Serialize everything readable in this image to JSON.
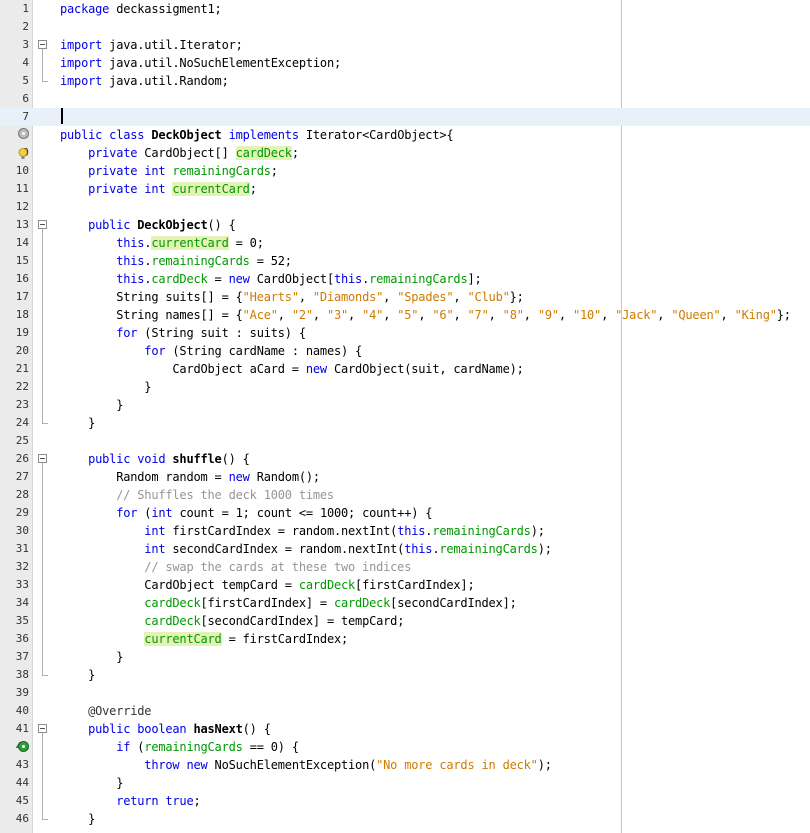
{
  "editor": {
    "lines": [
      {
        "n": "1",
        "parts": [
          {
            "t": "package",
            "c": "kw"
          },
          {
            "t": " deckassigment1;"
          }
        ]
      },
      {
        "n": "2",
        "parts": []
      },
      {
        "n": "3",
        "parts": [
          {
            "t": "import",
            "c": "kw"
          },
          {
            "t": " java.util.Iterator;"
          }
        ]
      },
      {
        "n": "4",
        "parts": [
          {
            "t": "import",
            "c": "kw"
          },
          {
            "t": " java.util.NoSuchElementException;"
          }
        ]
      },
      {
        "n": "5",
        "parts": [
          {
            "t": "import",
            "c": "kw"
          },
          {
            "t": " java.util.Random;"
          }
        ]
      },
      {
        "n": "6",
        "parts": []
      },
      {
        "n": "7",
        "parts": []
      },
      {
        "n": "8",
        "parts": [
          {
            "t": "public class ",
            "c": "kw"
          },
          {
            "t": "DeckObject",
            "c": "bold"
          },
          {
            "t": " implements",
            "c": "kw"
          },
          {
            "t": " Iterator<CardObject>{"
          }
        ]
      },
      {
        "n": "9",
        "parts": [
          {
            "t": "    private ",
            "c": "kw"
          },
          {
            "t": "CardObject[] "
          },
          {
            "t": "cardDeck",
            "c": "fld-hl"
          },
          {
            "t": ";"
          }
        ]
      },
      {
        "n": "10",
        "parts": [
          {
            "t": "    private int ",
            "c": "kw"
          },
          {
            "t": "remainingCards",
            "c": "fld"
          },
          {
            "t": ";"
          }
        ]
      },
      {
        "n": "11",
        "parts": [
          {
            "t": "    private int ",
            "c": "kw"
          },
          {
            "t": "currentCard",
            "c": "fld-hl"
          },
          {
            "t": ";"
          }
        ]
      },
      {
        "n": "12",
        "parts": []
      },
      {
        "n": "13",
        "parts": [
          {
            "t": "    public ",
            "c": "kw"
          },
          {
            "t": "DeckObject",
            "c": "bold"
          },
          {
            "t": "() {"
          }
        ]
      },
      {
        "n": "14",
        "parts": [
          {
            "t": "        this",
            "c": "kw"
          },
          {
            "t": "."
          },
          {
            "t": "currentCard",
            "c": "fld-hl"
          },
          {
            "t": " = 0;"
          }
        ]
      },
      {
        "n": "15",
        "parts": [
          {
            "t": "        this",
            "c": "kw"
          },
          {
            "t": "."
          },
          {
            "t": "remainingCards",
            "c": "fld"
          },
          {
            "t": " = 52;"
          }
        ]
      },
      {
        "n": "16",
        "parts": [
          {
            "t": "        this",
            "c": "kw"
          },
          {
            "t": "."
          },
          {
            "t": "cardDeck",
            "c": "fld"
          },
          {
            "t": " = "
          },
          {
            "t": "new",
            "c": "kw"
          },
          {
            "t": " CardObject["
          },
          {
            "t": "this",
            "c": "kw"
          },
          {
            "t": "."
          },
          {
            "t": "remainingCards",
            "c": "fld"
          },
          {
            "t": "];"
          }
        ]
      },
      {
        "n": "17",
        "parts": [
          {
            "t": "        String suits[] = {"
          },
          {
            "t": "\"Hearts\"",
            "c": "str"
          },
          {
            "t": ", "
          },
          {
            "t": "\"Diamonds\"",
            "c": "str"
          },
          {
            "t": ", "
          },
          {
            "t": "\"Spades\"",
            "c": "str"
          },
          {
            "t": ", "
          },
          {
            "t": "\"Club\"",
            "c": "str"
          },
          {
            "t": "};"
          }
        ]
      },
      {
        "n": "18",
        "parts": [
          {
            "t": "        String names[] = {"
          },
          {
            "t": "\"Ace\"",
            "c": "str"
          },
          {
            "t": ", "
          },
          {
            "t": "\"2\"",
            "c": "str"
          },
          {
            "t": ", "
          },
          {
            "t": "\"3\"",
            "c": "str"
          },
          {
            "t": ", "
          },
          {
            "t": "\"4\"",
            "c": "str"
          },
          {
            "t": ", "
          },
          {
            "t": "\"5\"",
            "c": "str"
          },
          {
            "t": ", "
          },
          {
            "t": "\"6\"",
            "c": "str"
          },
          {
            "t": ", "
          },
          {
            "t": "\"7\"",
            "c": "str"
          },
          {
            "t": ", "
          },
          {
            "t": "\"8\"",
            "c": "str"
          },
          {
            "t": ", "
          },
          {
            "t": "\"9\"",
            "c": "str"
          },
          {
            "t": ", "
          },
          {
            "t": "\"10\"",
            "c": "str"
          },
          {
            "t": ", "
          },
          {
            "t": "\"Jack\"",
            "c": "str"
          },
          {
            "t": ", "
          },
          {
            "t": "\"Queen\"",
            "c": "str"
          },
          {
            "t": ", "
          },
          {
            "t": "\"King\"",
            "c": "str"
          },
          {
            "t": "};"
          }
        ]
      },
      {
        "n": "19",
        "parts": [
          {
            "t": "        for",
            "c": "kw"
          },
          {
            "t": " (String suit : suits) {"
          }
        ]
      },
      {
        "n": "20",
        "parts": [
          {
            "t": "            for",
            "c": "kw"
          },
          {
            "t": " (String cardName : names) {"
          }
        ]
      },
      {
        "n": "21",
        "parts": [
          {
            "t": "                CardObject aCard = "
          },
          {
            "t": "new",
            "c": "kw"
          },
          {
            "t": " CardObject(suit, cardName);"
          }
        ]
      },
      {
        "n": "22",
        "parts": [
          {
            "t": "            }"
          }
        ]
      },
      {
        "n": "23",
        "parts": [
          {
            "t": "        }"
          }
        ]
      },
      {
        "n": "24",
        "parts": [
          {
            "t": "    }"
          }
        ]
      },
      {
        "n": "25",
        "parts": []
      },
      {
        "n": "26",
        "parts": [
          {
            "t": "    public void ",
            "c": "kw"
          },
          {
            "t": "shuffle",
            "c": "bold"
          },
          {
            "t": "() {"
          }
        ]
      },
      {
        "n": "27",
        "parts": [
          {
            "t": "        Random random = "
          },
          {
            "t": "new",
            "c": "kw"
          },
          {
            "t": " Random();"
          }
        ]
      },
      {
        "n": "28",
        "parts": [
          {
            "t": "        // Shuffles the deck 1000 times",
            "c": "cmt"
          }
        ]
      },
      {
        "n": "29",
        "parts": [
          {
            "t": "        for",
            "c": "kw"
          },
          {
            "t": " ("
          },
          {
            "t": "int",
            "c": "kw"
          },
          {
            "t": " count = 1; count <= 1000; count++) {"
          }
        ]
      },
      {
        "n": "30",
        "parts": [
          {
            "t": "            int",
            "c": "kw"
          },
          {
            "t": " firstCardIndex = random.nextInt("
          },
          {
            "t": "this",
            "c": "kw"
          },
          {
            "t": "."
          },
          {
            "t": "remainingCards",
            "c": "fld"
          },
          {
            "t": ");"
          }
        ]
      },
      {
        "n": "31",
        "parts": [
          {
            "t": "            int",
            "c": "kw"
          },
          {
            "t": " secondCardIndex = random.nextInt("
          },
          {
            "t": "this",
            "c": "kw"
          },
          {
            "t": "."
          },
          {
            "t": "remainingCards",
            "c": "fld"
          },
          {
            "t": ");"
          }
        ]
      },
      {
        "n": "32",
        "parts": [
          {
            "t": "            // swap the cards at these two indices",
            "c": "cmt"
          }
        ]
      },
      {
        "n": "33",
        "parts": [
          {
            "t": "            CardObject tempCard = "
          },
          {
            "t": "cardDeck",
            "c": "fld"
          },
          {
            "t": "[firstCardIndex];"
          }
        ]
      },
      {
        "n": "34",
        "parts": [
          {
            "t": "            "
          },
          {
            "t": "cardDeck",
            "c": "fld"
          },
          {
            "t": "[firstCardIndex] = "
          },
          {
            "t": "cardDeck",
            "c": "fld"
          },
          {
            "t": "[secondCardIndex];"
          }
        ]
      },
      {
        "n": "35",
        "parts": [
          {
            "t": "            "
          },
          {
            "t": "cardDeck",
            "c": "fld"
          },
          {
            "t": "[secondCardIndex] = tempCard;"
          }
        ]
      },
      {
        "n": "36",
        "parts": [
          {
            "t": "            "
          },
          {
            "t": "currentCard",
            "c": "fld-hl"
          },
          {
            "t": " = firstCardIndex;"
          }
        ]
      },
      {
        "n": "37",
        "parts": [
          {
            "t": "        }"
          }
        ]
      },
      {
        "n": "38",
        "parts": [
          {
            "t": "    }"
          }
        ]
      },
      {
        "n": "39",
        "parts": []
      },
      {
        "n": "40",
        "parts": [
          {
            "t": "    @Override",
            "c": "ann"
          }
        ]
      },
      {
        "n": "41",
        "parts": [
          {
            "t": "    public boolean ",
            "c": "kw"
          },
          {
            "t": "hasNext",
            "c": "bold"
          },
          {
            "t": "() {"
          }
        ]
      },
      {
        "n": "42",
        "parts": [
          {
            "t": "        if",
            "c": "kw"
          },
          {
            "t": " ("
          },
          {
            "t": "remainingCards",
            "c": "fld"
          },
          {
            "t": " == 0) {"
          }
        ]
      },
      {
        "n": "43",
        "parts": [
          {
            "t": "            throw new",
            "c": "kw"
          },
          {
            "t": " NoSuchElementException("
          },
          {
            "t": "\"No more cards in deck\"",
            "c": "str"
          },
          {
            "t": ");"
          }
        ]
      },
      {
        "n": "44",
        "parts": [
          {
            "t": "        }"
          }
        ]
      },
      {
        "n": "45",
        "parts": [
          {
            "t": "        return true",
            "c": "kw"
          },
          {
            "t": ";"
          }
        ]
      },
      {
        "n": "46",
        "parts": [
          {
            "t": "    }"
          }
        ]
      }
    ],
    "current_line": "7",
    "gutter_icons": [
      {
        "line": "8",
        "icon": "implements-icon"
      },
      {
        "line": "9",
        "icon": "warning-bulb-icon"
      },
      {
        "line": "41",
        "icon": "override-icon"
      }
    ],
    "colors": {
      "keyword": "#0000e6",
      "string": "#ce7b00",
      "field": "#009900",
      "comment": "#969696",
      "highlight": "#e4f3b5"
    }
  }
}
